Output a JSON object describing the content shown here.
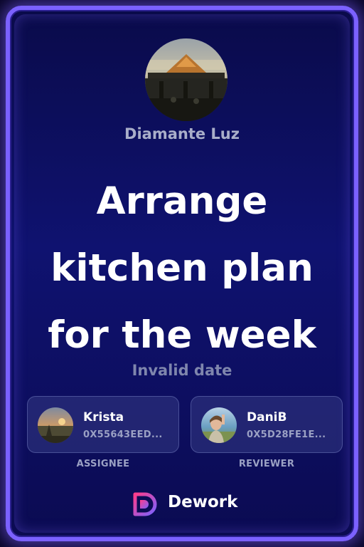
{
  "card": {
    "border_color": "#7b61ff",
    "background_color": "#0f1270"
  },
  "author": {
    "name": "Diamante Luz",
    "avatar": "profile-photo"
  },
  "task": {
    "title": "Arrange kitchen plan for the week",
    "due_date": "Invalid date"
  },
  "assignee": {
    "name": "Krista",
    "address": "0X55643EED...",
    "role": "ASSIGNEE",
    "avatar": "profile-photo"
  },
  "reviewer": {
    "name": "DaniB",
    "address": "0X5D28FE1E...",
    "role": "REVIEWER",
    "avatar": "profile-photo"
  },
  "brand": {
    "name": "Dework",
    "logo": "dework-logo-icon",
    "logo_colors": [
      "#ff3d8b",
      "#7b61ff"
    ]
  }
}
